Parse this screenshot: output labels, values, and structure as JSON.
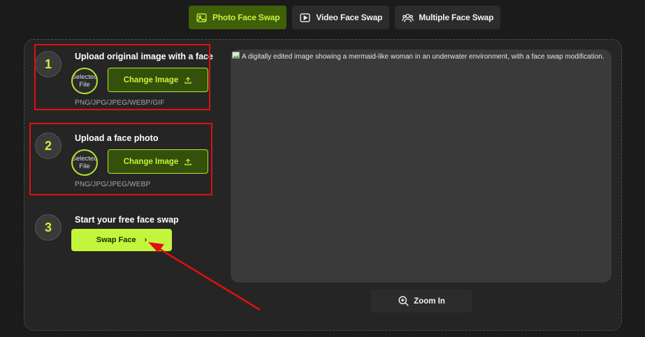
{
  "tabs": [
    {
      "label": "Photo Face Swap",
      "icon": "image-icon",
      "active": true
    },
    {
      "label": "Video Face Swap",
      "icon": "video-play-icon",
      "active": false
    },
    {
      "label": "Multiple Face Swap",
      "icon": "users-icon",
      "active": false
    }
  ],
  "steps": {
    "step1": {
      "number": "1",
      "title": "Upload original image with a face",
      "thumb_alt": "Selected File",
      "button": "Change Image",
      "formats": "PNG/JPG/JPEG/WEBP/GIF"
    },
    "step2": {
      "number": "2",
      "title": "Upload a face photo",
      "thumb_alt": "Selected File",
      "button": "Change Image",
      "formats": "PNG/JPG/JPEG/WEBP"
    },
    "step3": {
      "number": "3",
      "title": "Start your free face swap",
      "button": "Swap Face",
      "button_chevron": "›"
    }
  },
  "preview": {
    "alt_text": "A digitally edited image showing a mermaid-like woman in an underwater environment, with a face swap modification."
  },
  "zoom": {
    "label": "Zoom In"
  },
  "colors": {
    "accent": "#c3f53c",
    "accent_dark": "#3f5f09",
    "annotation_red": "#e10f0f",
    "background": "#1b1b1b"
  }
}
